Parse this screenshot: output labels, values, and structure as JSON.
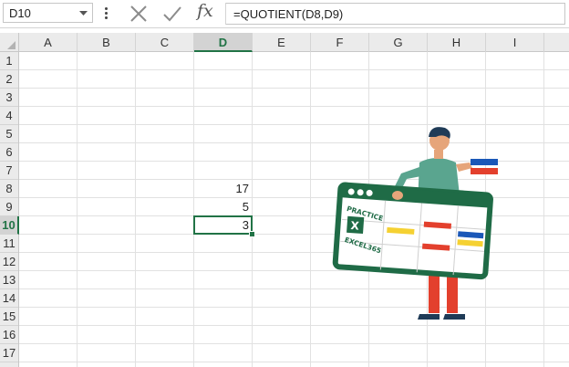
{
  "formula_bar": {
    "name_box": "D10",
    "cancel_icon": "cancel-x-icon",
    "enter_icon": "checkmark-icon",
    "function_label": "fx",
    "formula": "=QUOTIENT(D8,D9)"
  },
  "columns": [
    "A",
    "B",
    "C",
    "D",
    "E",
    "F",
    "G",
    "H",
    "I"
  ],
  "rows": [
    "1",
    "2",
    "3",
    "4",
    "5",
    "6",
    "7",
    "8",
    "9",
    "10",
    "11",
    "12",
    "13",
    "14",
    "15",
    "16",
    "17"
  ],
  "selected_column": "D",
  "selected_row": "10",
  "cells": [
    {
      "ref": "D8",
      "value": "17"
    },
    {
      "ref": "D9",
      "value": "5"
    },
    {
      "ref": "D10",
      "value": "3"
    }
  ],
  "illustration": {
    "badge_line1": "PRACTICE",
    "badge_line2": "EXCEL365",
    "logo_letter": "X"
  },
  "colors": {
    "accent_green": "#217346",
    "header_bg": "#ebebeb",
    "grid_line": "#e1e1e1"
  }
}
